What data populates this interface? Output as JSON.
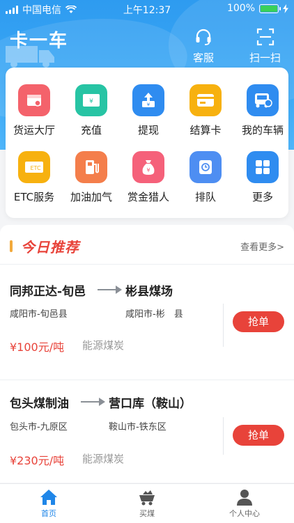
{
  "status_bar": {
    "carrier": "中国电信",
    "time": "上午12:37",
    "battery_percent": "100%",
    "battery_level": 1.0
  },
  "header": {
    "app_title": "卡一车",
    "customer_service_label": "客服",
    "scan_label": "扫一扫",
    "gradient_top": "#2e9bf0",
    "gradient_bottom": "#4fb6fb"
  },
  "services": [
    {
      "label": "货运大厅",
      "icon": "freight-hall-icon",
      "color": "#f4626b"
    },
    {
      "label": "充值",
      "icon": "recharge-icon",
      "color": "#27c4a4"
    },
    {
      "label": "提现",
      "icon": "withdraw-icon",
      "color": "#2f8cf0"
    },
    {
      "label": "结算卡",
      "icon": "settlement-card-icon",
      "color": "#f7b10f"
    },
    {
      "label": "我的车辆",
      "icon": "my-vehicle-icon",
      "color": "#2f8cf0"
    },
    {
      "label": "ETC服务",
      "icon": "etc-icon",
      "color": "#f7b10f"
    },
    {
      "label": "加油加气",
      "icon": "fuel-pump-icon",
      "color": "#f47e4b"
    },
    {
      "label": "赏金猎人",
      "icon": "money-bag-icon",
      "color": "#f5617a"
    },
    {
      "label": "排队",
      "icon": "queue-icon",
      "color": "#4e8ef2"
    },
    {
      "label": "更多",
      "icon": "more-grid-icon",
      "color": "#2f8cf0"
    }
  ],
  "recommend": {
    "title": "今日推荐",
    "more": "查看更多>",
    "accent": "#e8433a"
  },
  "orders": [
    {
      "from": "同邦正达-旬邑",
      "to": "彬县煤场",
      "from_city": "咸阳市-旬邑县",
      "to_city": "咸阳市-彬　县",
      "price": "¥100元/吨",
      "cargo": "能源煤炭",
      "action": "抢单"
    },
    {
      "from": "包头煤制油",
      "to": "营口库（鞍山）",
      "from_city": "包头市-九原区",
      "to_city": "鞍山市-铁东区",
      "price": "¥230元/吨",
      "cargo": "能源煤炭",
      "action": "抢单"
    }
  ],
  "tabbar": {
    "home": "首页",
    "buy_coal": "买煤",
    "profile": "个人中心",
    "active_color": "#1f86e8"
  }
}
